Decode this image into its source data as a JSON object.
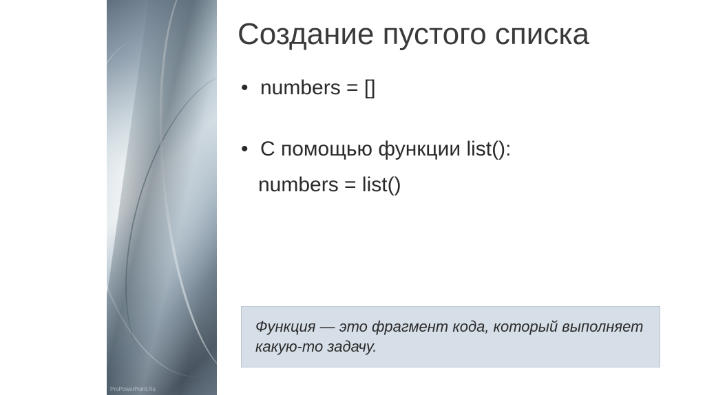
{
  "slide": {
    "title": "Создание пустого списка",
    "bullets": [
      {
        "text": "numbers = []"
      },
      {
        "text": "С помощью функции list():"
      }
    ],
    "sub_text": "numbers = list()",
    "definition": "Функция — это фрагмент кода, который выполняет какую-то задачу.",
    "watermark": "ProPowerPoint.Ru"
  }
}
